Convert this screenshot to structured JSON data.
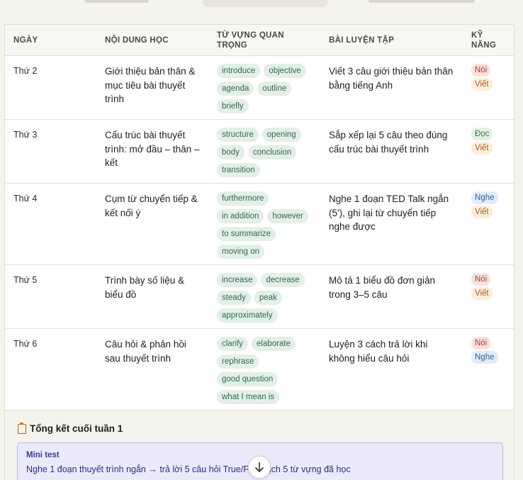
{
  "table": {
    "headers": {
      "day": "NGÀY",
      "content": "NỘI DUNG HỌC",
      "vocab": "TỪ VỰNG QUAN TRỌNG",
      "practice": "BÀI LUYỆN TẬP",
      "skill": "KỸ NĂNG"
    },
    "rows": [
      {
        "day": "Thứ 2",
        "content": "Giới thiệu bản thân & mục tiêu bài thuyết trình",
        "vocab": [
          "introduce",
          "objective",
          "agenda",
          "outline",
          "briefly"
        ],
        "practice": "Viết 3 câu giới thiệu bản thân bằng tiếng Anh",
        "skills": [
          {
            "label": "Nói",
            "kind": "noi"
          },
          {
            "label": "Viết",
            "kind": "viet"
          }
        ]
      },
      {
        "day": "Thứ 3",
        "content": "Cấu trúc bài thuyết trình: mở đầu – thân – kết",
        "vocab": [
          "structure",
          "opening",
          "body",
          "conclusion",
          "transition"
        ],
        "practice": "Sắp xếp lại 5 câu theo đúng cấu trúc bài thuyết trình",
        "skills": [
          {
            "label": "Đọc",
            "kind": "doc"
          },
          {
            "label": "Viết",
            "kind": "viet"
          }
        ]
      },
      {
        "day": "Thứ 4",
        "content": "Cụm từ chuyển tiếp & kết nối ý",
        "vocab": [
          "furthermore",
          "in addition",
          "however",
          "to summarize",
          "moving on"
        ],
        "practice": "Nghe 1 đoạn TED Talk ngắn (5'), ghi lại từ chuyển tiếp nghe được",
        "skills": [
          {
            "label": "Nghe",
            "kind": "nghe"
          },
          {
            "label": "Viết",
            "kind": "viet"
          }
        ]
      },
      {
        "day": "Thứ 5",
        "content": "Trình bày số liệu & biểu đồ",
        "vocab": [
          "increase",
          "decrease",
          "steady",
          "peak",
          "approximately"
        ],
        "practice": "Mô tả 1 biểu đồ đơn giản trong 3–5 câu",
        "skills": [
          {
            "label": "Nói",
            "kind": "noi"
          },
          {
            "label": "Viết",
            "kind": "viet"
          }
        ]
      },
      {
        "day": "Thứ 6",
        "content": "Câu hỏi & phản hồi sau thuyết trình",
        "vocab": [
          "clarify",
          "elaborate",
          "rephrase",
          "good question",
          "what I mean is"
        ],
        "practice": "Luyện 3 cách trả lời khi không hiểu câu hỏi",
        "skills": [
          {
            "label": "Nói",
            "kind": "noi"
          },
          {
            "label": "Nghe",
            "kind": "nghe"
          }
        ]
      }
    ]
  },
  "summary": {
    "icon": "clipboard-icon",
    "title": "Tổng kết cuối tuần 1",
    "mini_test_label": "Mini test",
    "mini_test_text_before": "Nghe 1 đoạn thuyết trình ngắn → trả lời 5 câu hỏi True/Fa",
    "mini_test_text_after": "ịch 5 từ vựng đã học"
  },
  "scroll_button": {
    "icon": "arrow-down-icon"
  }
}
